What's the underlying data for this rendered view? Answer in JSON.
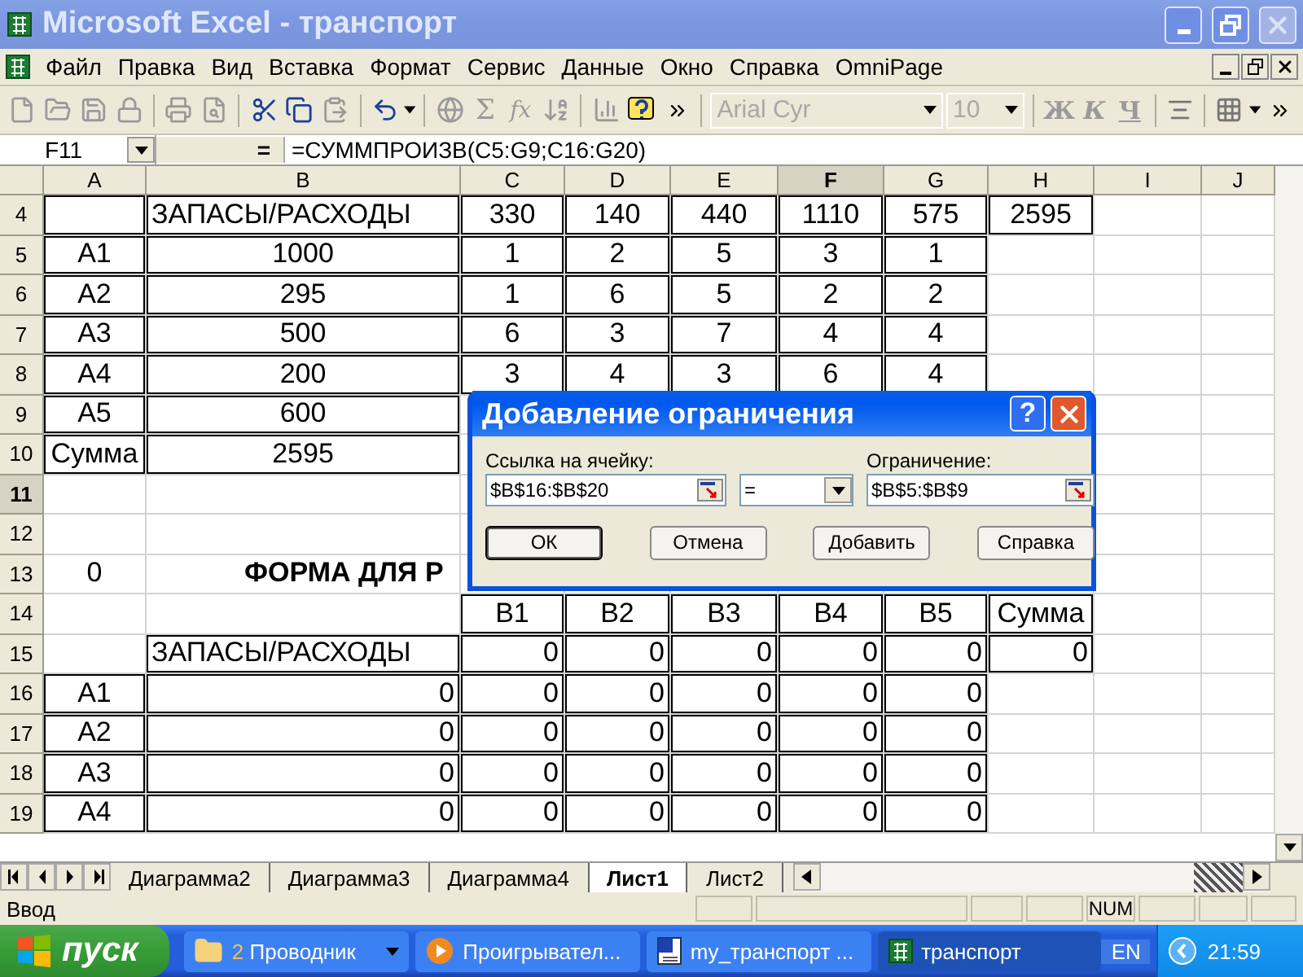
{
  "window": {
    "title": "Microsoft Excel - транспорт"
  },
  "menu": {
    "items": [
      "Файл",
      "Правка",
      "Вид",
      "Вставка",
      "Формат",
      "Сервис",
      "Данные",
      "Окно",
      "Справка",
      "OmniPage"
    ]
  },
  "toolbar": {
    "sum_glyph": "Σ",
    "function_glyph": "fx",
    "font": "Arial Cyr",
    "font_size": "10",
    "bold_glyph": "Ж",
    "italic_glyph": "К",
    "underline_glyph": "Ч",
    "formatting_disabled": true
  },
  "formula_bar": {
    "cell": "F11",
    "equals": "=",
    "formula": "=СУММПРОИЗВ(C5:G9;C16:G20)"
  },
  "columns": [
    {
      "label": "A",
      "selected": false
    },
    {
      "label": "B",
      "selected": false
    },
    {
      "label": "C",
      "selected": false
    },
    {
      "label": "D",
      "selected": false
    },
    {
      "label": "E",
      "selected": false
    },
    {
      "label": "F",
      "selected": true
    },
    {
      "label": "G",
      "selected": false
    },
    {
      "label": "H",
      "selected": false
    },
    {
      "label": "I",
      "selected": false
    },
    {
      "label": "J",
      "selected": false
    }
  ],
  "rows": [
    {
      "number": "4",
      "selected": false,
      "cells": [
        {
          "boxed": true
        },
        {
          "text": "ЗАПАСЫ/РАСХОДЫ",
          "kind": "heading",
          "boxed": true
        },
        {
          "text": "330",
          "kind": "label",
          "boxed": true
        },
        {
          "text": "140",
          "kind": "label",
          "boxed": true
        },
        {
          "text": "440",
          "kind": "label",
          "boxed": true
        },
        {
          "text": "1110",
          "kind": "label",
          "boxed": true
        },
        {
          "text": "575",
          "kind": "label",
          "boxed": true
        },
        {
          "text": "2595",
          "kind": "label",
          "boxed": true
        },
        null,
        null
      ]
    },
    {
      "number": "5",
      "selected": false,
      "cells": [
        {
          "text": "А1",
          "kind": "label",
          "boxed": true
        },
        {
          "text": "1000",
          "kind": "label",
          "boxed": true
        },
        {
          "text": "1",
          "kind": "label",
          "boxed": true
        },
        {
          "text": "2",
          "kind": "label",
          "boxed": true
        },
        {
          "text": "5",
          "kind": "label",
          "boxed": true
        },
        {
          "text": "3",
          "kind": "label",
          "boxed": true
        },
        {
          "text": "1",
          "kind": "label",
          "boxed": true
        },
        null,
        null,
        null
      ]
    },
    {
      "number": "6",
      "selected": false,
      "cells": [
        {
          "text": "А2",
          "kind": "label",
          "boxed": true
        },
        {
          "text": "295",
          "kind": "label",
          "boxed": true
        },
        {
          "text": "1",
          "kind": "label",
          "boxed": true
        },
        {
          "text": "6",
          "kind": "label",
          "boxed": true
        },
        {
          "text": "5",
          "kind": "label",
          "boxed": true
        },
        {
          "text": "2",
          "kind": "label",
          "boxed": true
        },
        {
          "text": "2",
          "kind": "label",
          "boxed": true
        },
        null,
        null,
        null
      ]
    },
    {
      "number": "7",
      "selected": false,
      "cells": [
        {
          "text": "А3",
          "kind": "label",
          "boxed": true
        },
        {
          "text": "500",
          "kind": "label",
          "boxed": true
        },
        {
          "text": "6",
          "kind": "label",
          "boxed": true
        },
        {
          "text": "3",
          "kind": "label",
          "boxed": true
        },
        {
          "text": "7",
          "kind": "label",
          "boxed": true
        },
        {
          "text": "4",
          "kind": "label",
          "boxed": true
        },
        {
          "text": "4",
          "kind": "label",
          "boxed": true
        },
        null,
        null,
        null
      ]
    },
    {
      "number": "8",
      "selected": false,
      "cells": [
        {
          "text": "А4",
          "kind": "label",
          "boxed": true
        },
        {
          "text": "200",
          "kind": "label",
          "boxed": true
        },
        {
          "text": "3",
          "kind": "label",
          "boxed": true
        },
        {
          "text": "4",
          "kind": "label",
          "boxed": true
        },
        {
          "text": "3",
          "kind": "label",
          "boxed": true
        },
        {
          "text": "6",
          "kind": "label",
          "boxed": true
        },
        {
          "text": "4",
          "kind": "label",
          "boxed": true
        },
        null,
        null,
        null
      ]
    },
    {
      "number": "9",
      "selected": false,
      "cells": [
        {
          "text": "А5",
          "kind": "label",
          "boxed": true
        },
        {
          "text": "600",
          "kind": "label",
          "boxed": true
        },
        null,
        null,
        null,
        null,
        null,
        null,
        null,
        null
      ]
    },
    {
      "number": "10",
      "selected": false,
      "cells": [
        {
          "text": "Сумма",
          "kind": "label",
          "boxed": true
        },
        {
          "text": "2595",
          "kind": "label",
          "boxed": true
        },
        null,
        null,
        null,
        null,
        null,
        null,
        null,
        null
      ]
    },
    {
      "number": "11",
      "selected": true,
      "cells": [
        null,
        null,
        null,
        null,
        null,
        null,
        null,
        null,
        null,
        null
      ]
    },
    {
      "number": "12",
      "selected": false,
      "cells": [
        null,
        null,
        null,
        null,
        null,
        null,
        null,
        null,
        null,
        null
      ]
    },
    {
      "number": "13",
      "selected": false,
      "cells": [
        {
          "text": "0",
          "kind": "label"
        },
        {
          "text": "ФОРМА ДЛЯ Р",
          "kind": "title"
        },
        null,
        null,
        null,
        null,
        null,
        null,
        null,
        null
      ]
    },
    {
      "number": "14",
      "selected": false,
      "cells": [
        null,
        null,
        {
          "text": "В1",
          "kind": "label",
          "boxed": true
        },
        {
          "text": "В2",
          "kind": "label",
          "boxed": true
        },
        {
          "text": "В3",
          "kind": "label",
          "boxed": true
        },
        {
          "text": "В4",
          "kind": "label",
          "boxed": true
        },
        {
          "text": "В5",
          "kind": "label",
          "boxed": true
        },
        {
          "text": "Сумма",
          "kind": "label",
          "boxed": true
        },
        null,
        null
      ]
    },
    {
      "number": "15",
      "selected": false,
      "cells": [
        null,
        {
          "text": "ЗАПАСЫ/РАСХОДЫ",
          "kind": "heading",
          "boxed": true
        },
        {
          "text": "0",
          "kind": "value",
          "boxed": true
        },
        {
          "text": "0",
          "kind": "value",
          "boxed": true
        },
        {
          "text": "0",
          "kind": "value",
          "boxed": true
        },
        {
          "text": "0",
          "kind": "value",
          "boxed": true
        },
        {
          "text": "0",
          "kind": "value",
          "boxed": true
        },
        {
          "text": "0",
          "kind": "value",
          "boxed": true
        },
        null,
        null
      ]
    },
    {
      "number": "16",
      "selected": false,
      "cells": [
        {
          "text": "А1",
          "kind": "label",
          "boxed": true
        },
        {
          "text": "0",
          "kind": "value",
          "boxed": true
        },
        {
          "text": "0",
          "kind": "value",
          "boxed": true
        },
        {
          "text": "0",
          "kind": "value",
          "boxed": true
        },
        {
          "text": "0",
          "kind": "value",
          "boxed": true
        },
        {
          "text": "0",
          "kind": "value",
          "boxed": true
        },
        {
          "text": "0",
          "kind": "value",
          "boxed": true
        },
        null,
        null,
        null
      ]
    },
    {
      "number": "17",
      "selected": false,
      "cells": [
        {
          "text": "А2",
          "kind": "label",
          "boxed": true
        },
        {
          "text": "0",
          "kind": "value",
          "boxed": true
        },
        {
          "text": "0",
          "kind": "value",
          "boxed": true
        },
        {
          "text": "0",
          "kind": "value",
          "boxed": true
        },
        {
          "text": "0",
          "kind": "value",
          "boxed": true
        },
        {
          "text": "0",
          "kind": "value",
          "boxed": true
        },
        {
          "text": "0",
          "kind": "value",
          "boxed": true
        },
        null,
        null,
        null
      ]
    },
    {
      "number": "18",
      "selected": false,
      "cells": [
        {
          "text": "А3",
          "kind": "label",
          "boxed": true
        },
        {
          "text": "0",
          "kind": "value",
          "boxed": true
        },
        {
          "text": "0",
          "kind": "value",
          "boxed": true
        },
        {
          "text": "0",
          "kind": "value",
          "boxed": true
        },
        {
          "text": "0",
          "kind": "value",
          "boxed": true
        },
        {
          "text": "0",
          "kind": "value",
          "boxed": true
        },
        {
          "text": "0",
          "kind": "value",
          "boxed": true
        },
        null,
        null,
        null
      ]
    },
    {
      "number": "19",
      "selected": false,
      "cells": [
        {
          "text": "А4",
          "kind": "label",
          "boxed": true
        },
        {
          "text": "0",
          "kind": "value",
          "boxed": true
        },
        {
          "text": "0",
          "kind": "value",
          "boxed": true
        },
        {
          "text": "0",
          "kind": "value",
          "boxed": true
        },
        {
          "text": "0",
          "kind": "value",
          "boxed": true
        },
        {
          "text": "0",
          "kind": "value",
          "boxed": true
        },
        {
          "text": "0",
          "kind": "value",
          "boxed": true
        },
        null,
        null,
        null
      ]
    }
  ],
  "dialog": {
    "title": "Добавление ограничения",
    "help": "?",
    "reference_label": "Ссылка на ячейку:",
    "reference": "$B$16:$B$20",
    "operator": "=",
    "constraint_label": "Ограничение:",
    "constraint": "$B$5:$B$9",
    "buttons": [
      {
        "label": "ОК",
        "default": true
      },
      {
        "label": "Отмена",
        "default": false
      },
      {
        "label": "Добавить",
        "default": false
      },
      {
        "label": "Справка",
        "default": false
      }
    ]
  },
  "sheet_tabs": [
    {
      "label": "Диаграмма2",
      "selected": false
    },
    {
      "label": "Диаграмма3",
      "selected": false
    },
    {
      "label": "Диаграмма4",
      "selected": false
    },
    {
      "label": "Лист1",
      "selected": true
    },
    {
      "label": "Лист2",
      "selected": false
    }
  ],
  "status_bar": {
    "mode": "Ввод",
    "indicator": "NUM"
  },
  "taskbar": {
    "start": "пуск",
    "tasks": [
      {
        "label": "Проводник",
        "count": "2",
        "kind": "folder",
        "selected": false
      },
      {
        "label": "Проигрывател...",
        "kind": "player",
        "selected": false
      },
      {
        "label": "my_транспорт ...",
        "kind": "document",
        "selected": false
      },
      {
        "label": "транспорт",
        "kind": "spreadsheet",
        "selected": true
      }
    ],
    "language": "EN",
    "clock": "21:59"
  }
}
